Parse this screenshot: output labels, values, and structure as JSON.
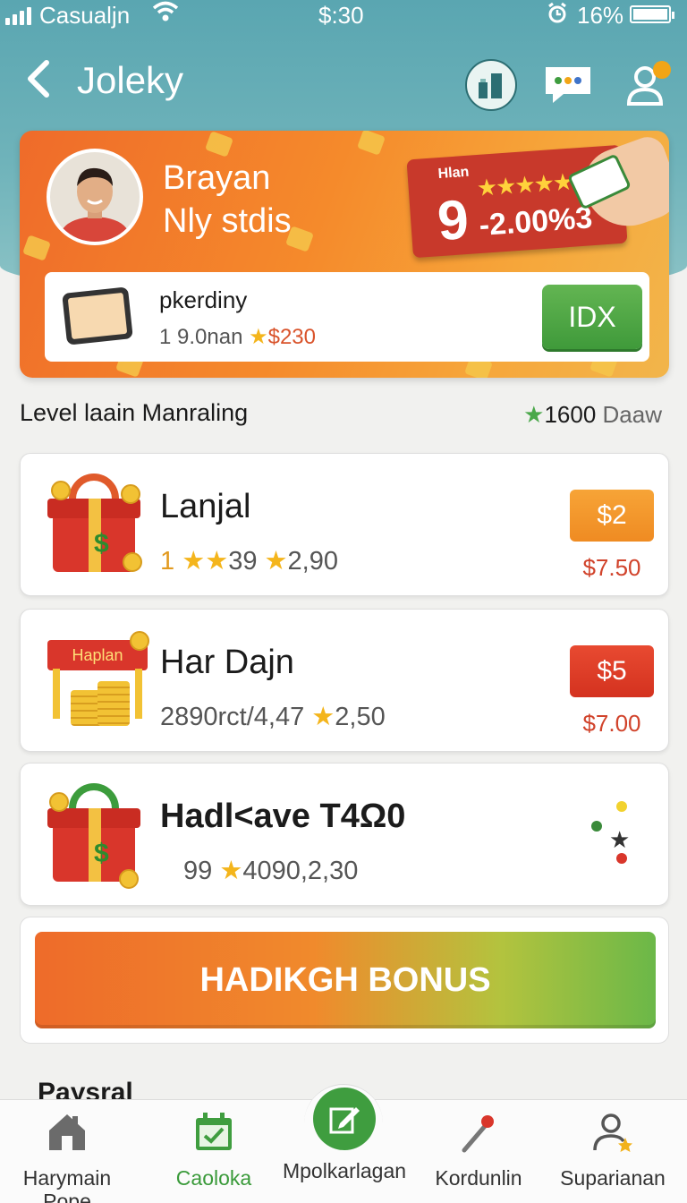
{
  "status_bar": {
    "carrier": "Casualjn",
    "time": "$:30",
    "battery": "16%"
  },
  "nav": {
    "title": "Joleky",
    "icons": [
      "stats-icon",
      "chat-icon",
      "profile-icon"
    ]
  },
  "banner": {
    "name": "Brayan",
    "subtitle": "Nly stdis",
    "rank_label": "Hlan",
    "rank_number": "9",
    "rank_change": "-2.00%3",
    "offer": {
      "title": "pkerdiny",
      "meta_prefix": "1 9.0nan",
      "price": "$230",
      "button": "IDX"
    }
  },
  "level": {
    "label": "Level laain Manraling",
    "score": "1600",
    "unit": "Daaw"
  },
  "items": [
    {
      "title": "Lanjal",
      "meta_lead": "1",
      "meta_a": "39",
      "meta_b": "2,90",
      "price": "$2",
      "sub_price": "$7.50"
    },
    {
      "title": "Har Dajn",
      "image_label": "Haplan",
      "meta_text": "2890rct/4,47",
      "meta_b": "2,50",
      "price": "$5",
      "sub_price": "$7.00"
    },
    {
      "title": "Hadl<ave T4Ω0",
      "meta_lead": "99",
      "meta_b": "4090,2,30"
    }
  ],
  "bonus_button": "HADIKGH BONUS",
  "section_peek": "Paysral",
  "tabs": [
    {
      "label": "Harymain",
      "label2": "Pope",
      "icon": "home-icon"
    },
    {
      "label": "Caoloka",
      "icon": "calendar-check-icon",
      "active": true
    },
    {
      "label": "Mpolkarlagan",
      "icon": "edit-icon"
    },
    {
      "label": "Kordunlin",
      "icon": "pin-icon"
    },
    {
      "label": "Suparianan",
      "icon": "user-star-icon"
    }
  ],
  "colors": {
    "accent_orange": "#ef8b22",
    "accent_green": "#3f9d3f",
    "price_red": "#d1432b"
  }
}
